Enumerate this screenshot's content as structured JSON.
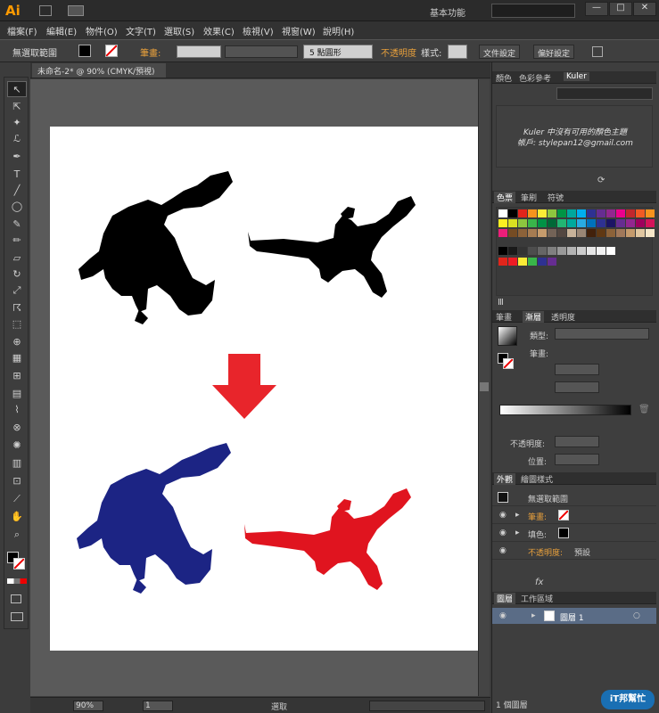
{
  "app": {
    "logo": "Ai",
    "workspace": "基本功能",
    "search_placeholder": ""
  },
  "menu": [
    "檔案(F)",
    "編輯(E)",
    "物件(O)",
    "文字(T)",
    "選取(S)",
    "效果(C)",
    "檢視(V)",
    "視窗(W)",
    "說明(H)"
  ],
  "control": {
    "selection": "無選取範圍",
    "stroke_label": "筆畫:",
    "brush": "5 點圓形",
    "opacity_label": "不透明度",
    "style_label": "樣式:",
    "doc_setup": "文件設定",
    "prefs": "偏好設定"
  },
  "document": {
    "tab": "未命名-2* @ 90% (CMYK/預視)"
  },
  "status": {
    "zoom": "90%",
    "page": "1",
    "mode": "選取"
  },
  "kuler": {
    "tabs": [
      "顏色",
      "色彩參考",
      "Kuler"
    ],
    "message": "Kuler 中沒有可用的顏色主題",
    "account": "帳戶: stylepan12@gmail.com"
  },
  "swatches": {
    "tabs": [
      "色票",
      "筆刷",
      "符號"
    ],
    "row1": [
      "#ffffff",
      "#000000",
      "#e1251b",
      "#f7941d",
      "#fbeb36",
      "#8dc63f",
      "#009444",
      "#00a79d",
      "#00aeef",
      "#2e3192",
      "#662d91",
      "#92278f",
      "#ec008c",
      "#c1272d",
      "#f15a24",
      "#f7931e"
    ],
    "row2": [
      "#fcee21",
      "#d9e021",
      "#8cc63f",
      "#39b54a",
      "#009245",
      "#006837",
      "#22b573",
      "#00a99d",
      "#29abe2",
      "#0071bc",
      "#2e3192",
      "#1b1464",
      "#662d91",
      "#93278f",
      "#9e005d",
      "#d4145a"
    ],
    "row3": [
      "#ed1e79",
      "#754c24",
      "#8c6239",
      "#a67c52",
      "#c69c6d",
      "#736357",
      "#534741",
      "#c7b299",
      "#998675",
      "#42210b",
      "#603813",
      "#8c6239",
      "#a0785a",
      "#c49a6c",
      "#e0c6a0",
      "#f5e6c8"
    ],
    "row4": [
      "#000000",
      "#1a1a1a",
      "#333333",
      "#4d4d4d",
      "#666666",
      "#808080",
      "#999999",
      "#b3b3b3",
      "#cccccc",
      "#e6e6e6",
      "#f2f2f2",
      "#ffffff"
    ],
    "row5": [
      "#e1251b",
      "#ed1c24",
      "#fbeb36",
      "#39b54a",
      "#2e3192",
      "#662d91"
    ]
  },
  "gradient": {
    "tabs": [
      "筆畫",
      "漸層",
      "透明度"
    ],
    "type_label": "類型:",
    "stroke_label": "筆畫:",
    "opacity_label": "不透明度:",
    "location_label": "位置:"
  },
  "appearance": {
    "tabs": [
      "外觀",
      "繪圖樣式"
    ],
    "title": "無選取範圍",
    "rows": [
      {
        "label": "筆畫:",
        "value": ""
      },
      {
        "label": "填色:",
        "value": ""
      },
      {
        "label": "不透明度:",
        "value": "預設"
      }
    ]
  },
  "layers": {
    "tabs": [
      "圖層",
      "工作區域"
    ],
    "layer_name": "圖層 1",
    "footer": "1 個圖層"
  },
  "watermark": "iT邦幫忙",
  "colors": {
    "blue": "#1c2484",
    "red": "#e0141f",
    "arrow": "#e8252b",
    "black": "#000000"
  },
  "icons": [
    "selection-tool-icon",
    "direct-selection-icon",
    "magic-wand-icon",
    "lasso-icon",
    "pen-icon",
    "type-icon",
    "line-icon",
    "ellipse-icon",
    "paintbrush-icon",
    "pencil-icon",
    "eraser-icon",
    "rotate-icon",
    "scale-icon",
    "warp-icon",
    "free-transform-icon",
    "shape-builder-icon",
    "perspective-icon",
    "mesh-icon",
    "gradient-icon",
    "eyedropper-icon",
    "blend-icon",
    "symbol-sprayer-icon",
    "graph-icon",
    "artboard-icon",
    "slice-icon",
    "hand-icon",
    "zoom-icon"
  ]
}
